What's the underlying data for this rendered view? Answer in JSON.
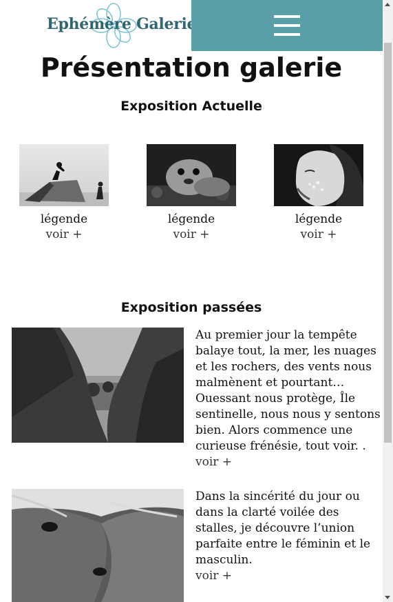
{
  "header": {
    "logo_text": "Ephémère Galerie",
    "menu_icon": "hamburger-menu-icon",
    "menu_color": "#5a9ea7",
    "logo_color": "#2f6672"
  },
  "page": {
    "title": "Présentation galerie"
  },
  "current_exhibition": {
    "title": "Exposition Actuelle",
    "items": [
      {
        "legend": "légende",
        "more": "voir +",
        "image": "workers-on-concrete-block-photo"
      },
      {
        "legend": "légende",
        "more": "voir +",
        "image": "seal-photo"
      },
      {
        "legend": "légende",
        "more": "voir +",
        "image": "woman-face-photo"
      }
    ]
  },
  "past_exhibitions": {
    "title": "Exposition passées",
    "items": [
      {
        "text": "Au premier jour la tempête balaye tout, la mer, les nuages et les rochers, des vents nous malmènent et pourtant… Ouessant nous protège, Île sentinelle, nous nous y sentons bien. Alors commence une curieuse frénésie, tout voir. .",
        "more": "voir +",
        "image": "rocky-coast-photo"
      },
      {
        "text": "Dans la sincérité du jour ou dans la clarté voilée des stalles, je découvre l’union parfaite entre le féminin et le masculin.",
        "more": "voir +",
        "image": "horses-closeup-photo"
      }
    ]
  }
}
